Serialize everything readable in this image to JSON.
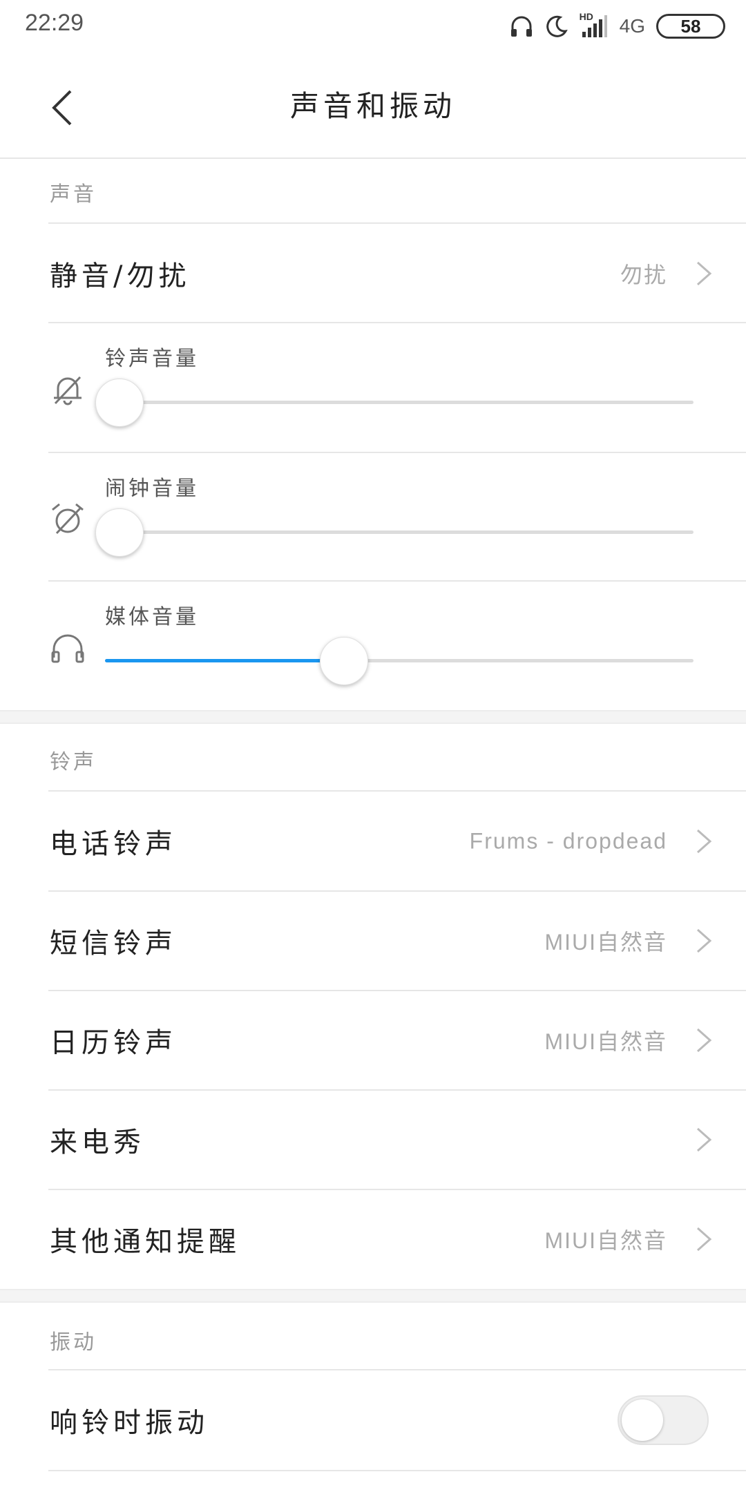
{
  "status_bar": {
    "time": "22:29",
    "network": "4G",
    "hd": "HD",
    "battery": "58"
  },
  "header": {
    "title": "声音和振动"
  },
  "sound_section": {
    "title": "声音",
    "dnd_row": {
      "label": "静音/勿扰",
      "value": "勿扰"
    },
    "volumes": [
      {
        "label": "铃声音量",
        "icon": "bell-muted-icon",
        "level": 0.0
      },
      {
        "label": "闹钟音量",
        "icon": "alarm-off-icon",
        "level": 0.0
      },
      {
        "label": "媒体音量",
        "icon": "headphones-icon",
        "level": 0.405
      }
    ]
  },
  "ringtone_section": {
    "title": "铃声",
    "items": [
      {
        "label": "电话铃声",
        "value": "Frums - dropdead"
      },
      {
        "label": "短信铃声",
        "value": "MIUI自然音"
      },
      {
        "label": "日历铃声",
        "value": "MIUI自然音"
      },
      {
        "label": "来电秀",
        "value": ""
      },
      {
        "label": "其他通知提醒",
        "value": "MIUI自然音"
      }
    ]
  },
  "vibration_section": {
    "title": "振动",
    "items": [
      {
        "label": "响铃时振动",
        "enabled": false
      }
    ]
  },
  "colors": {
    "accent": "#1a96f0",
    "divider": "#e6e6e6",
    "secondary_text": "#999999"
  }
}
